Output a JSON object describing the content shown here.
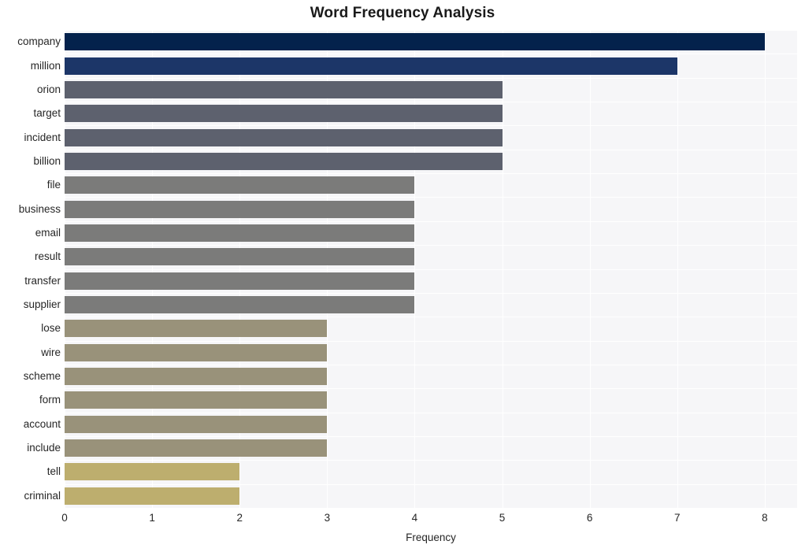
{
  "chart_data": {
    "type": "bar",
    "orientation": "horizontal",
    "title": "Word Frequency Analysis",
    "xlabel": "Frequency",
    "ylabel": "",
    "categories": [
      "company",
      "million",
      "orion",
      "target",
      "incident",
      "billion",
      "file",
      "business",
      "email",
      "result",
      "transfer",
      "supplier",
      "lose",
      "wire",
      "scheme",
      "form",
      "account",
      "include",
      "tell",
      "criminal"
    ],
    "values": [
      8,
      7,
      5,
      5,
      5,
      5,
      4,
      4,
      4,
      4,
      4,
      4,
      3,
      3,
      3,
      3,
      3,
      3,
      2,
      2
    ],
    "bar_colors": [
      "#04224c",
      "#1c3668",
      "#5d616e",
      "#5d616e",
      "#5d616e",
      "#5d616e",
      "#7b7b7a",
      "#7b7b7a",
      "#7b7b7a",
      "#7b7b7a",
      "#7b7b7a",
      "#7b7b7a",
      "#99927a",
      "#99927a",
      "#99927a",
      "#99927a",
      "#99927a",
      "#99927a",
      "#bdae6e",
      "#bdae6e"
    ],
    "xlim": [
      0,
      8.37
    ],
    "xticks": [
      0,
      1,
      2,
      3,
      4,
      5,
      6,
      7,
      8
    ],
    "xtick_labels": [
      "0",
      "1",
      "2",
      "3",
      "4",
      "5",
      "6",
      "7",
      "8"
    ],
    "grid": true,
    "grid_color": "#ffffff",
    "plot_background": "#f6f6f8",
    "figure_background": "#ffffff",
    "legend": null
  }
}
